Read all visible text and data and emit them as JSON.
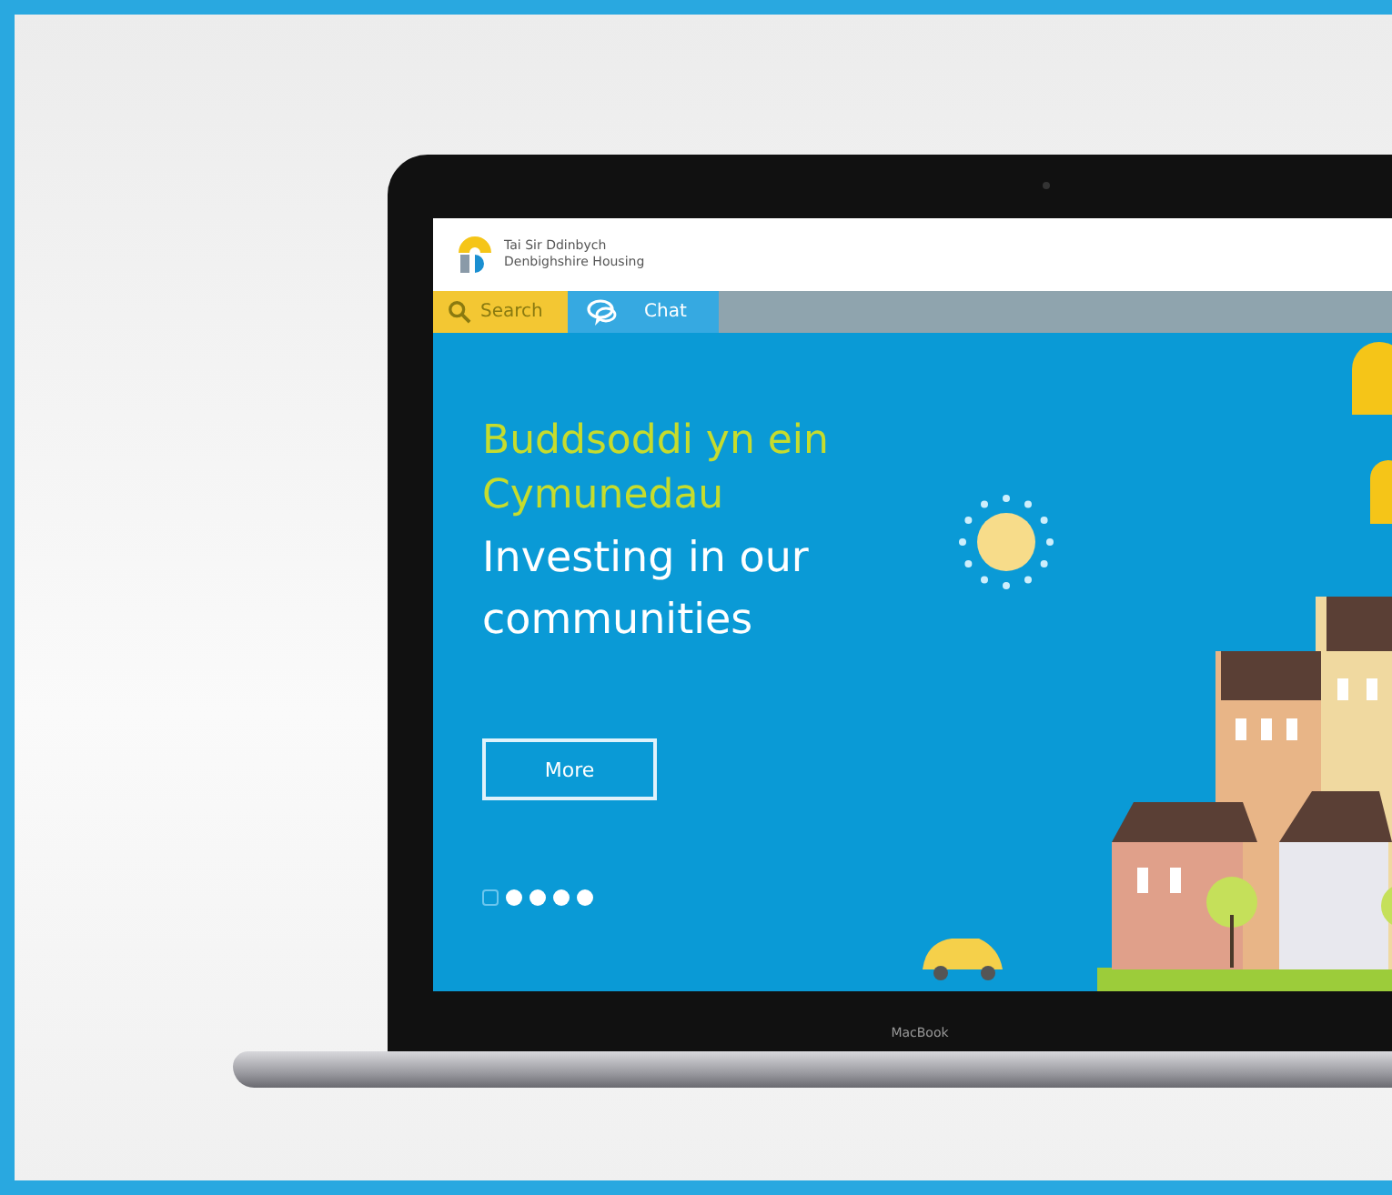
{
  "logo": {
    "lines": [
      "Tai Sir Ddinbych",
      "Denbighshire Housing"
    ]
  },
  "nav": [
    {
      "kind": "search",
      "label": "Search"
    },
    {
      "kind": "chat",
      "label": "Chat"
    }
  ],
  "hero": {
    "title_welsh": "Buddsoddi yn ein Cymunedau",
    "title_english": "Investing in our communities",
    "button": "More",
    "dots": [
      {
        "selected": true
      },
      {
        "selected": false
      },
      {
        "selected": false
      },
      {
        "selected": false
      },
      {
        "selected": false
      }
    ]
  },
  "device": {
    "label": "MacBook"
  }
}
